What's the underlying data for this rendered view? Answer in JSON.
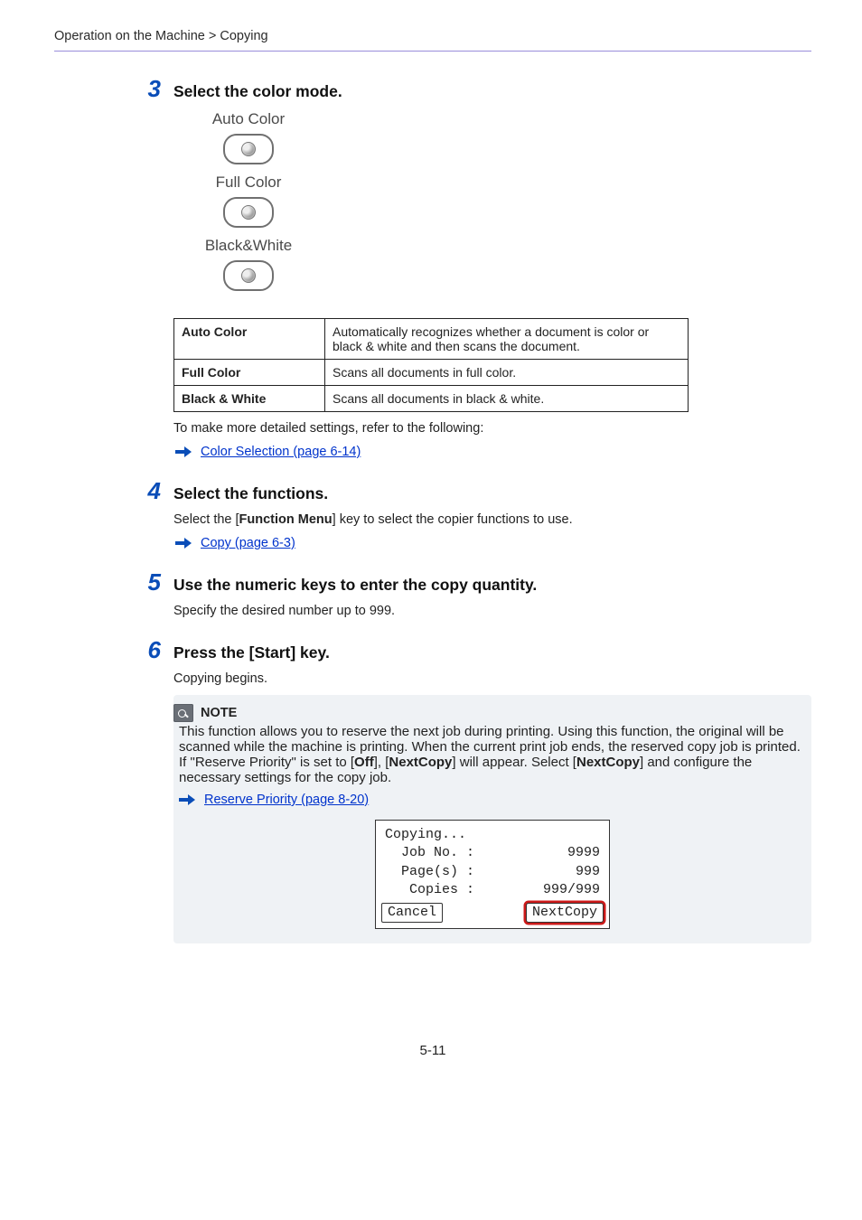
{
  "breadcrumb": "Operation on the Machine > Copying",
  "page_number": "5-11",
  "step3": {
    "num": "3",
    "title": "Select the color mode.",
    "modes": {
      "auto": "Auto Color",
      "full": "Full Color",
      "bw": "Black&White"
    },
    "table": {
      "r1h": "Auto Color",
      "r1d": "Automatically recognizes whether a document is color or black & white and then scans the document.",
      "r2h": "Full Color",
      "r2d": "Scans all documents in full color.",
      "r3h": "Black & White",
      "r3d": "Scans all documents in black & white."
    },
    "more": "To make more detailed settings, refer to the following:",
    "link": "Color Selection (page 6-14)"
  },
  "step4": {
    "num": "4",
    "title": "Select the functions.",
    "body_pre": "Select the [",
    "body_bold": "Function Menu",
    "body_post": "] key to select the copier functions to use.",
    "link": "Copy (page 6-3)"
  },
  "step5": {
    "num": "5",
    "title": "Use the numeric keys to enter the copy quantity.",
    "body": "Specify the desired number up to 999."
  },
  "step6": {
    "num": "6",
    "title": "Press the [Start] key.",
    "body": "Copying begins."
  },
  "note": {
    "label": "NOTE",
    "p1_a": "This function allows you to reserve the next job during printing. Using this function, the original will be scanned while the machine is printing. When the current print job ends, the reserved copy job is printed. If \"Reserve Priority\" is set to [",
    "p1_b": "Off",
    "p1_c": "], [",
    "p1_d": "NextCopy",
    "p1_e": "] will appear. Select [",
    "p1_f": "NextCopy",
    "p1_g": "] and configure the necessary settings for the copy job.",
    "link": "Reserve Priority (page 8-20)"
  },
  "lcd": {
    "title": "Copying...",
    "jobno_l": "  Job No. :",
    "jobno_v": "9999",
    "pages_l": "  Page(s) :",
    "pages_v": "999",
    "copies_l": "   Copies :",
    "copies_v": "999/999",
    "cancel": "Cancel",
    "next": "NextCopy"
  }
}
